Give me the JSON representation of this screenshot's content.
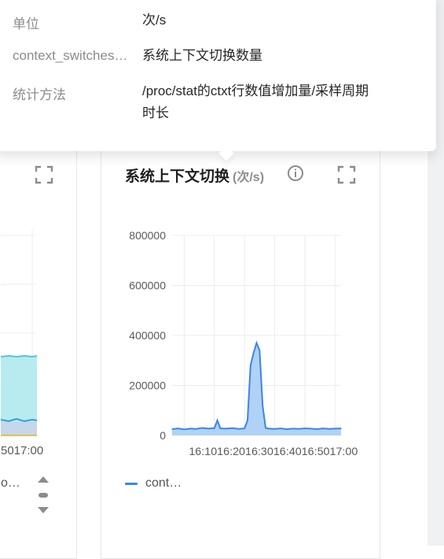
{
  "popover": {
    "rows": [
      {
        "key": "单位",
        "value": "次/s"
      },
      {
        "key": "context_switches…",
        "value": "系统上下文切换数量"
      },
      {
        "key": "统计方法",
        "value": "/proc/stat的ctxt行数值增加量/采样周期时长"
      }
    ]
  },
  "left_card": {
    "x_tick_last": "5017:00",
    "legend_text": "o…"
  },
  "main_card": {
    "title": "系统上下文切换",
    "unit": "(次/s)",
    "legend_label": "cont…"
  },
  "colors": {
    "series_line": "#3a86e8",
    "series_fill": "#a8ccf5",
    "left_cyan_fill": "#b7ebf0",
    "left_cyan_line": "#4fc8d8"
  },
  "chart_data": [
    {
      "type": "area",
      "title": "系统上下文切换 (次/s)",
      "y_ticks": [
        "0",
        "200000",
        "400000",
        "600000",
        "800000"
      ],
      "ylim": [
        0,
        800000
      ],
      "x_ticks": [
        "16:10",
        "16:20",
        "16:30",
        "16:40",
        "16:50",
        "17:00"
      ],
      "x_tick_label_text": "16:1016:2016:3016:4016:5017:00",
      "grid": true,
      "legend": "bottom",
      "series": [
        {
          "name": "cont…",
          "x": [
            "16:06",
            "16:08",
            "16:10",
            "16:12",
            "16:14",
            "16:16",
            "16:18",
            "16:20",
            "16:21",
            "16:22",
            "16:24",
            "16:26",
            "16:28",
            "16:30",
            "16:31",
            "16:32",
            "16:33",
            "16:34",
            "16:35",
            "16:36",
            "16:37",
            "16:38",
            "16:40",
            "16:42",
            "16:44",
            "16:46",
            "16:48",
            "16:50",
            "16:52",
            "16:54",
            "16:56",
            "16:58",
            "17:00",
            "17:02"
          ],
          "values": [
            25000,
            28000,
            24000,
            27000,
            26000,
            30000,
            27000,
            29000,
            60000,
            28000,
            27000,
            29000,
            26000,
            28000,
            60000,
            280000,
            330000,
            370000,
            340000,
            120000,
            30000,
            27000,
            26000,
            28000,
            25000,
            27000,
            26000,
            28000,
            27000,
            25000,
            28000,
            26000,
            27000,
            28000
          ]
        }
      ]
    }
  ]
}
